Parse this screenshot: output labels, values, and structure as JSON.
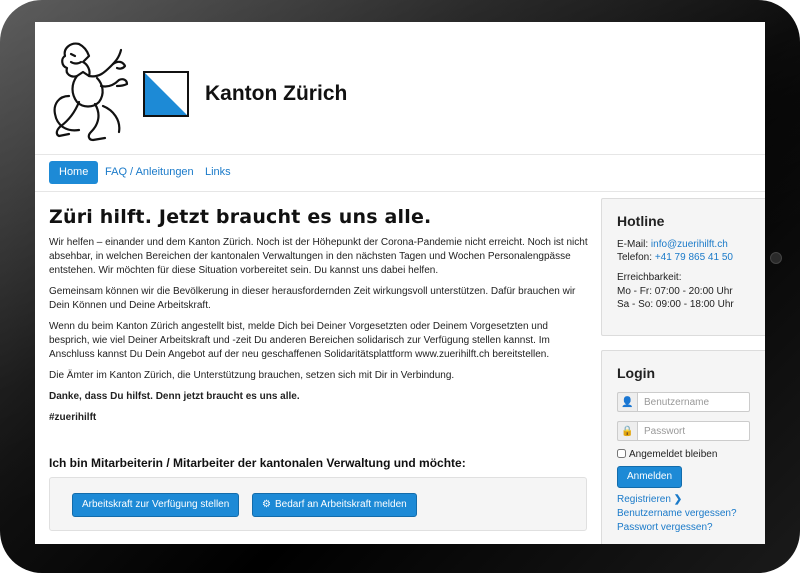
{
  "site": {
    "title": "Kanton Zürich",
    "accent_color": "#1d8ad6"
  },
  "nav": {
    "items": [
      {
        "label": "Home"
      },
      {
        "label": "FAQ / Anleitungen"
      },
      {
        "label": "Links"
      }
    ]
  },
  "main": {
    "heading": "Züri hilft. Jetzt braucht es uns alle.",
    "paragraphs": [
      "Wir helfen – einander und dem Kanton Zürich. Noch ist der Höhepunkt der Corona-Pandemie nicht erreicht. Noch ist nicht absehbar, in welchen Bereichen der kantonalen Verwaltungen in den nächsten Tagen und Wochen Personalengpässe entstehen. Wir möchten für diese Situation vorbereitet sein. Du kannst uns dabei helfen.",
      "Gemeinsam können wir die Bevölkerung in dieser herausfordernden Zeit wirkungsvoll unterstützen. Dafür brauchen wir Dein Können und Deine Arbeitskraft.",
      "Wenn du beim Kanton Zürich angestellt bist, melde Dich bei Deiner Vorgesetzten oder Deinem Vorgesetzten und besprich, wie viel Deiner Arbeitskraft und -zeit Du anderen Bereichen solidarisch zur Verfügung stellen kannst. Im Anschluss kannst Du Dein Angebot auf der neu geschaffenen Solidaritätsplattform www.zuerihilft.ch bereitstellen.",
      "Die Ämter im Kanton Zürich, die Unterstützung brauchen, setzen sich mit Dir in Verbindung."
    ],
    "bold_line": "Danke, dass Du hilfst. Denn jetzt braucht es uns alle.",
    "hashtag": "#zuerihilft",
    "subheading": "Ich bin Mitarbeiterin / Mitarbeiter der kantonalen Verwaltung und möchte:",
    "btn_offer": "Arbeitskraft zur Verfügung stellen",
    "btn_request": "Bedarf an Arbeitskraft melden"
  },
  "hotline": {
    "title": "Hotline",
    "email_label": "E-Mail:",
    "email": "info@zuerihilft.ch",
    "phone_label": "Telefon:",
    "phone": "+41 79 865 41 50",
    "reach_label": "Erreichbarkeit:",
    "hours_week": "Mo - Fr: 07:00 - 20:00 Uhr",
    "hours_weekend": "Sa - So: 09:00 - 18:00 Uhr"
  },
  "login": {
    "title": "Login",
    "username_placeholder": "Benutzername",
    "password_placeholder": "Passwort",
    "remember_label": "Angemeldet bleiben",
    "submit_label": "Anmelden",
    "register_link": "Registrieren",
    "forgot_user_link": "Benutzername vergessen?",
    "forgot_pass_link": "Passwort vergessen?"
  }
}
